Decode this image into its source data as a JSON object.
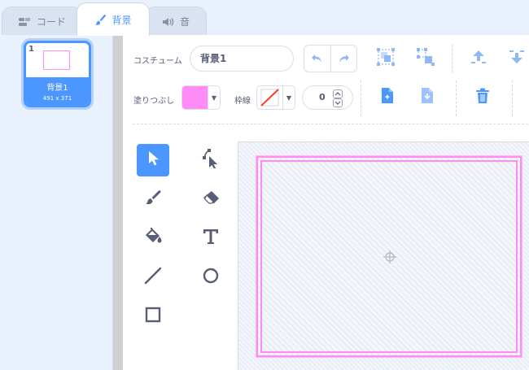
{
  "tabs": [
    {
      "label": "コード",
      "icon": "code-blocks-icon"
    },
    {
      "label": "背景",
      "icon": "paintbrush-icon",
      "active": true
    },
    {
      "label": "音",
      "icon": "speaker-icon"
    }
  ],
  "costumes": [
    {
      "number": "1",
      "name": "背景1",
      "size": "491 x 371",
      "selected": true
    }
  ],
  "toolbar": {
    "costume_label": "コスチューム",
    "costume_name": "背景1",
    "fill_label": "塗りつぶし",
    "outline_label": "枠線",
    "outline_width": "0"
  },
  "colors": {
    "accent": "#4c97ff",
    "fill": "#ff8cf5",
    "stage_border": "#ff8cf5"
  },
  "tools": [
    {
      "name": "select",
      "icon": "arrow-select-icon",
      "active": true
    },
    {
      "name": "reshape",
      "icon": "reshape-icon"
    },
    {
      "name": "brush",
      "icon": "brush-icon"
    },
    {
      "name": "eraser",
      "icon": "eraser-icon"
    },
    {
      "name": "fill",
      "icon": "paint-bucket-icon"
    },
    {
      "name": "text",
      "icon": "text-icon"
    },
    {
      "name": "line",
      "icon": "line-icon"
    },
    {
      "name": "circle",
      "icon": "circle-icon"
    },
    {
      "name": "rectangle",
      "icon": "rectangle-icon"
    }
  ]
}
